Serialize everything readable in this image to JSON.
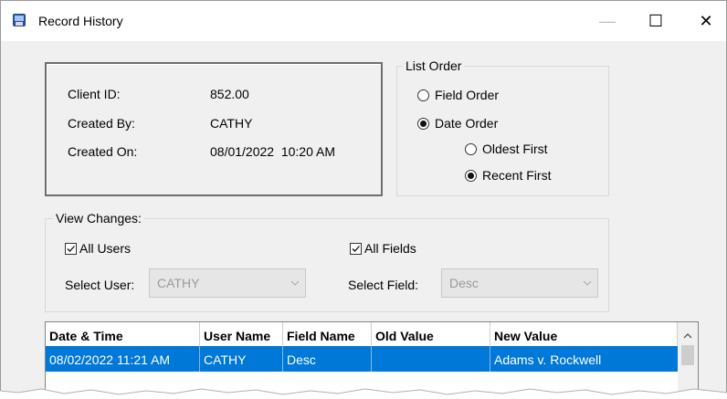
{
  "window": {
    "title": "Record History",
    "minimize": "—",
    "maximize": "☐",
    "close": "✕"
  },
  "info": {
    "client_id_label": "Client ID:",
    "client_id_value": "852.00",
    "created_by_label": "Created By:",
    "created_by_value": "CATHY",
    "created_on_label": "Created On:",
    "created_on_value": "08/01/2022  10:20 AM"
  },
  "list_order": {
    "legend": "List Order",
    "field_order": "Field Order",
    "field_order_selected": false,
    "date_order": "Date Order",
    "date_order_selected": true,
    "oldest_first": "Oldest First",
    "oldest_first_selected": false,
    "recent_first": "Recent First",
    "recent_first_selected": true
  },
  "view_changes": {
    "legend": "View Changes:",
    "all_users": "All Users",
    "all_users_checked": true,
    "all_fields": "All Fields",
    "all_fields_checked": true,
    "select_user_label": "Select User:",
    "select_user_value": "CATHY",
    "select_field_label": "Select Field:",
    "select_field_value": "Desc"
  },
  "grid": {
    "columns": [
      "Date & Time",
      "User Name",
      "Field Name",
      "Old Value",
      "New Value"
    ],
    "rows": [
      [
        "08/02/2022 11:21 AM",
        "CATHY",
        "Desc",
        "",
        "Adams v. Rockwell"
      ]
    ]
  },
  "colors": {
    "selection": "#0078d7",
    "window_bg": "#f0f0f0"
  }
}
